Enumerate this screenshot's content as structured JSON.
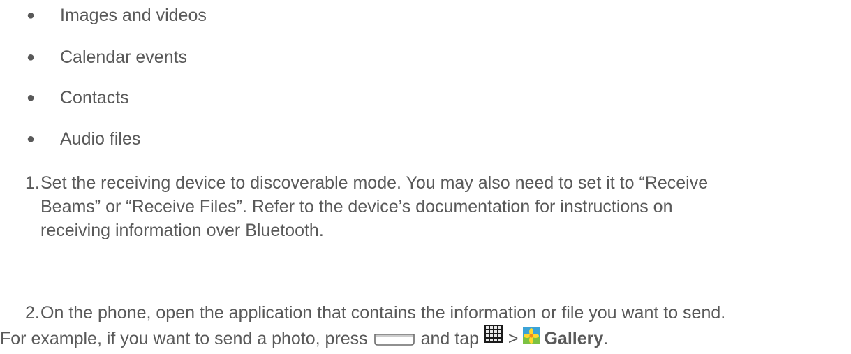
{
  "bullets": [
    "Images and videos",
    "Calendar events",
    "Contacts",
    "Audio files"
  ],
  "bullet_glyph": "●",
  "steps": [
    {
      "number": "1.",
      "lines": [
        "Set the receiving device to discoverable mode. You may also need to set it to “Receive",
        "Beams” or “Receive Files”. Refer to the device’s documentation for instructions on",
        "receiving information over Bluetooth."
      ]
    },
    {
      "number": "2.",
      "line1": "On the phone, open the application that contains the information or file you want to send.",
      "line2_prefix": "For example, if you want to send a photo, press",
      "line2_and_tap": "and tap",
      "line2_separator": ">",
      "line2_target": "Gallery",
      "line2_end": "."
    }
  ],
  "icons": {
    "home_key": "home-key-icon",
    "apps": "apps-grid-icon",
    "gallery": "gallery-icon"
  }
}
